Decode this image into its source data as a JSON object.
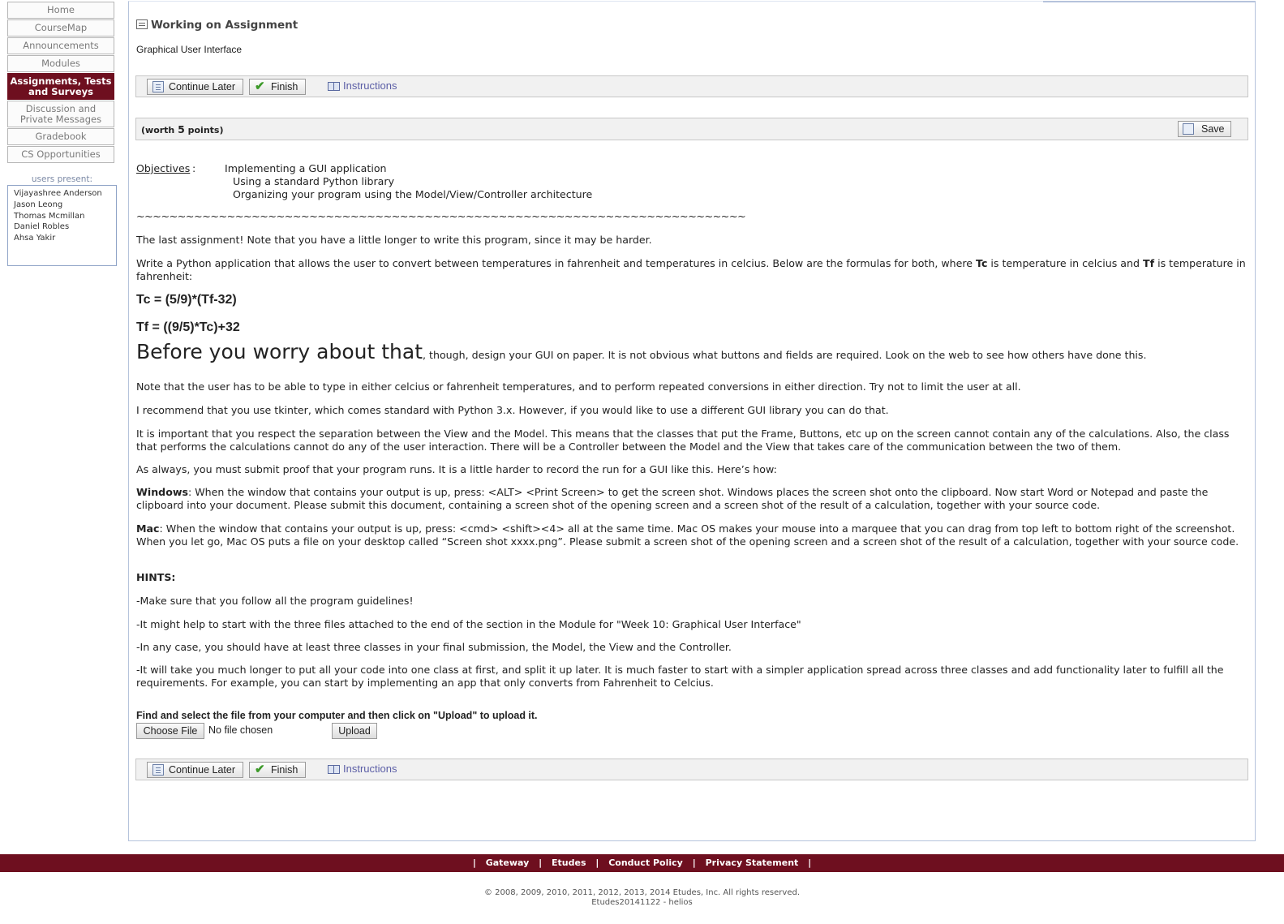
{
  "nav": {
    "items": [
      {
        "label": "Home"
      },
      {
        "label": "CourseMap"
      },
      {
        "label": "Announcements"
      },
      {
        "label": "Modules"
      },
      {
        "label": "Assignments, Tests and Surveys",
        "active": true
      },
      {
        "label": "Discussion and Private Messages"
      },
      {
        "label": "Gradebook"
      },
      {
        "label": "CS Opportunities"
      }
    ]
  },
  "presence": {
    "label": "users present:",
    "users": [
      "Vijayashree Anderson",
      "Jason Leong",
      "Thomas Mcmillan",
      "Daniel Robles",
      "Ahsa Yakir"
    ]
  },
  "header": {
    "title": "Working on Assignment",
    "subtitle": "Graphical User Interface"
  },
  "toolbar": {
    "continue_label": "Continue Later",
    "finish_label": "Finish",
    "instructions_label": "Instructions"
  },
  "question": {
    "worth_prefix": "(worth ",
    "worth_points": "5",
    "worth_suffix": " points)",
    "save_label": "Save"
  },
  "content": {
    "objectives_label": "Objectives",
    "objectives": [
      "Implementing a GUI application",
      "Using a standard Python library",
      "Organizing your program using the Model/View/Controller architecture"
    ],
    "divider": "~~~~~~~~~~~~~~~~~~~~~~~~~~~~~~~~~~~~~~~~~~~~~~~~~~~~~~~~~~~~~~~~~~~~~~~~~~",
    "p1": "The last assignment! Note that you have a little longer to write this program, since it may be harder.",
    "p2_a": "Write a Python application that allows the user to convert between temperatures in fahrenheit and temperatures in celcius. Below are the formulas for both, where ",
    "p2_tc": "Tc",
    "p2_b": " is temperature in celcius and ",
    "p2_tf": "Tf",
    "p2_c": " is temperature in fahrenheit:",
    "formula1": "Tc = (5/9)*(Tf-32)",
    "formula2": "Tf = ((9/5)*Tc)+32",
    "p3_big": "Before you worry about that",
    "p3_rest": ", though, design your GUI on paper. It is not obvious what buttons and fields are required. Look on the web to see how others have done this.",
    "p4": "Note that the user has to be able to type in either celcius or fahrenheit temperatures, and to perform repeated conversions in either direction. Try not to limit the user at all.",
    "p5": "I recommend that you use tkinter, which comes standard with Python 3.x. However, if you would like to use a different GUI library you can do that.",
    "p6": "It is important that you respect the separation between the View and the Model. This means that the classes that put the Frame, Buttons, etc up on the screen cannot contain any of the calculations. Also, the class that performs the calculations cannot do any of the user interaction. There will be a Controller between the Model and the View that takes care of the communication between the two of them.",
    "p7": "As always, you must submit proof that your program runs. It is a little harder to record the run for a GUI like this. Here’s how:",
    "win_label": "Windows",
    "win_text": ": When the window that contains your output is up, press: <ALT> <Print Screen> to get the screen shot. Windows places the screen shot onto the clipboard. Now start Word or Notepad and paste the clipboard into your document. Please submit this document, containing a screen shot of the opening screen and a screen shot of the result of a calculation, together with your source code.",
    "mac_label": "Mac",
    "mac_text": ": When the window that contains your output is up, press: <cmd> <shift><4> all at the same time. Mac OS makes your mouse into a marquee that you can drag from top left to bottom right of the screenshot. When you let go, Mac OS puts a file on your desktop called “Screen shot xxxx.png”. Please submit a screen shot of the opening screen and a screen shot of the result of a calculation, together with your source code.",
    "hints_label": "HINTS:",
    "hint1": "-Make sure that you follow all the program guidelines!",
    "hint2": "-It might help to start with the three files attached to the end of the section in the Module for \"Week 10: Graphical User Interface\"",
    "hint3": "-In any case, you should have at least three classes in your final submission, the Model, the View and the Controller.",
    "hint4": "-It will take you much longer to put all your code into one class at first, and split it up later. It is much faster to start with a simpler application spread across three classes and add functionality later to fulfill all the requirements. For example, you can start by implementing an app that only converts from Fahrenheit to Celcius."
  },
  "upload": {
    "label": "Find and select the file from your computer and then click on \"Upload\" to upload it.",
    "choose_label": "Choose File",
    "no_file": "No file chosen",
    "upload_label": "Upload"
  },
  "footer": {
    "links": [
      "Gateway",
      "Etudes",
      "Conduct Policy",
      "Privacy Statement"
    ],
    "copyright": "© 2008, 2009, 2010, 2011, 2012, 2013, 2014 Etudes, Inc. All rights reserved.",
    "build": "Etudes20141122 - helios"
  }
}
